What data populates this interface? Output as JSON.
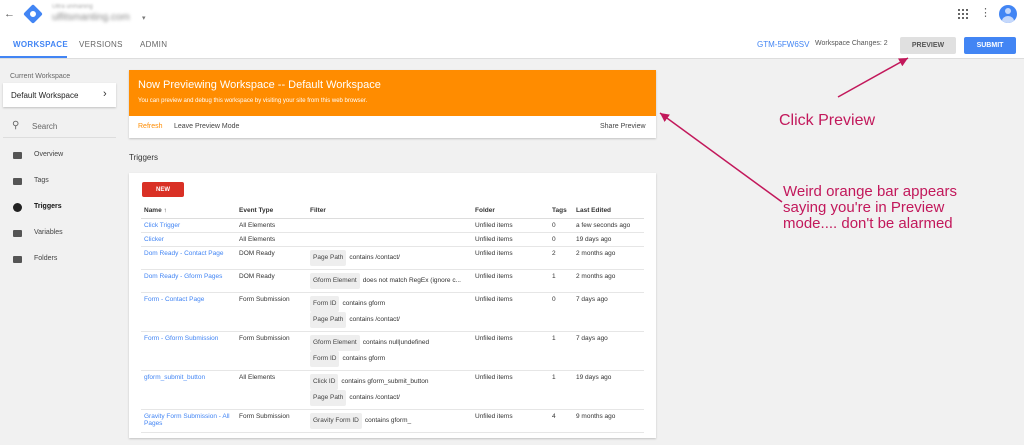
{
  "topbar": {
    "back_icon": "arrow-left-icon",
    "logo_icon": "tag-manager-logo",
    "account_label": "Ultra unmaning",
    "account_name": "ulfitsmanting.com",
    "account_caret": "▾",
    "apps_icon": "apps-grid-icon",
    "more_icon": "vertical-dots-icon",
    "avatar_icon": "user-avatar-icon"
  },
  "nav": {
    "tabs": [
      {
        "label": "WORKSPACE",
        "active": true
      },
      {
        "label": "VERSIONS",
        "active": false
      },
      {
        "label": "ADMIN",
        "active": false
      }
    ],
    "container_id": "GTM-5FW6SV",
    "workspace_changes": "Workspace Changes: 2",
    "preview_label": "PREVIEW",
    "submit_label": "SUBMIT"
  },
  "sidebar": {
    "current_workspace_label": "Current Workspace",
    "current_workspace_name": "Default Workspace",
    "search_placeholder": "Search",
    "items": [
      {
        "label": "Overview",
        "icon": "folder-icon",
        "active": false
      },
      {
        "label": "Tags",
        "icon": "tag-icon",
        "active": false
      },
      {
        "label": "Triggers",
        "icon": "trigger-icon",
        "active": true
      },
      {
        "label": "Variables",
        "icon": "variables-icon",
        "active": false
      },
      {
        "label": "Folders",
        "icon": "folder-icon",
        "active": false
      }
    ]
  },
  "banner": {
    "title": "Now Previewing Workspace -- Default Workspace",
    "description": "You can preview and debug this workspace by visiting your site from this web browser.",
    "refresh_label": "Refresh",
    "leave_label": "Leave Preview Mode",
    "share_label": "Share Preview",
    "color": "#ff8c00"
  },
  "triggers": {
    "heading": "Triggers",
    "new_label": "NEW",
    "columns": {
      "name": "Name ↑",
      "event_type": "Event Type",
      "filter": "Filter",
      "folder": "Folder",
      "tags": "Tags",
      "last_edited": "Last Edited"
    },
    "rows": [
      {
        "name": "Click Trigger",
        "event_type": "All Elements",
        "filters": [],
        "folder": "Unfiled items",
        "tags": "0",
        "last_edited": "a few seconds ago"
      },
      {
        "name": "Clicker",
        "event_type": "All Elements",
        "filters": [],
        "folder": "Unfiled items",
        "tags": "0",
        "last_edited": "19 days ago"
      },
      {
        "name": "Dom Ready - Contact Page",
        "event_type": "DOM Ready",
        "filters": [
          {
            "var": "Page Path",
            "cond": "contains /contact/"
          }
        ],
        "folder": "Unfiled items",
        "tags": "2",
        "last_edited": "2 months ago"
      },
      {
        "name": "Dom Ready - Gform Pages",
        "event_type": "DOM Ready",
        "filters": [
          {
            "var": "Gform Element",
            "cond": "does not match RegEx (ignore c..."
          }
        ],
        "folder": "Unfiled items",
        "tags": "1",
        "last_edited": "2 months ago"
      },
      {
        "name": "Form - Contact Page",
        "event_type": "Form Submission",
        "filters": [
          {
            "var": "Form ID",
            "cond": "contains gform"
          },
          {
            "var": "Page Path",
            "cond": "contains /contact/"
          }
        ],
        "folder": "Unfiled items",
        "tags": "0",
        "last_edited": "7 days ago"
      },
      {
        "name": "Form - Gform Submission",
        "event_type": "Form Submission",
        "filters": [
          {
            "var": "Gform Element",
            "cond": "contains null|undefined"
          },
          {
            "var": "Form ID",
            "cond": "contains gform"
          }
        ],
        "folder": "Unfiled items",
        "tags": "1",
        "last_edited": "7 days ago"
      },
      {
        "name": "gform_submit_button",
        "event_type": "All Elements",
        "filters": [
          {
            "var": "Click ID",
            "cond": "contains gform_submit_button"
          },
          {
            "var": "Page Path",
            "cond": "contains /contact/"
          }
        ],
        "folder": "Unfiled items",
        "tags": "1",
        "last_edited": "19 days ago"
      },
      {
        "name": "Gravity Form Submission - All Pages",
        "event_type": "Form Submission",
        "filters": [
          {
            "var": "Gravity Form ID",
            "cond": "contains gform_"
          }
        ],
        "folder": "Unfiled items",
        "tags": "4",
        "last_edited": "9 months ago"
      }
    ]
  },
  "annotations": {
    "click_preview": "Click Preview",
    "orange_bar_note": "Weird orange bar appears saying you're in Preview mode.... don't be alarmed",
    "color": "#c2185b"
  }
}
